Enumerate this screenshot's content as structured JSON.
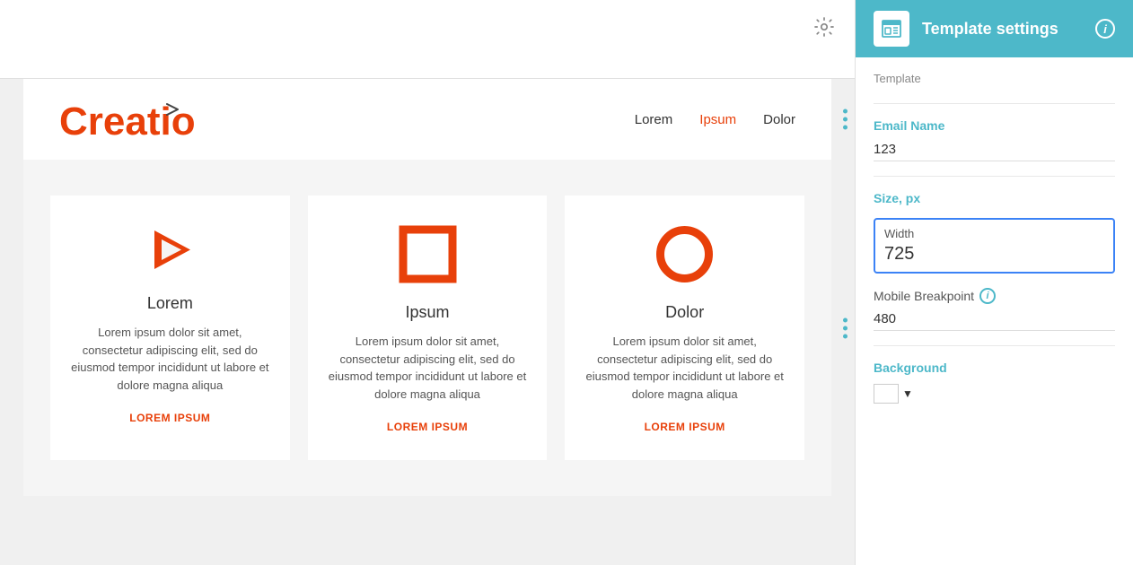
{
  "panel": {
    "header": {
      "title": "Template settings",
      "icon_label": "template-icon",
      "info_label": "i"
    },
    "section_template": "Template",
    "email_name_label": "Email Name",
    "email_name_value": "123",
    "size_label": "Size, px",
    "width_label": "Width",
    "width_value": "725",
    "mobile_bp_label": "Mobile Breakpoint",
    "mobile_bp_value": "480",
    "background_label": "Background"
  },
  "email": {
    "logo": "Creatio",
    "nav": [
      "Lorem",
      "Ipsum",
      "Dolor"
    ],
    "nav_active": "Ipsum",
    "columns": [
      {
        "title": "Lorem",
        "text": "Lorem ipsum dolor sit amet, consectetur adipiscing elit, sed do eiusmod tempor incididunt ut labore et dolore magna aliqua",
        "link": "LOREM IPSUM",
        "icon": "play"
      },
      {
        "title": "Ipsum",
        "text": "Lorem ipsum dolor sit amet, consectetur adipiscing elit, sed do eiusmod tempor incididunt ut labore et dolore magna aliqua",
        "link": "LOREM IPSUM",
        "icon": "square"
      },
      {
        "title": "Dolor",
        "text": "Lorem ipsum dolor sit amet, consectetur adipiscing elit, sed do eiusmod tempor incididunt ut labore et dolore magna aliqua",
        "link": "LOREM IPSUM",
        "icon": "circle"
      }
    ]
  },
  "gear_icon": "⚙",
  "cursor_label": "pointer-cursor"
}
